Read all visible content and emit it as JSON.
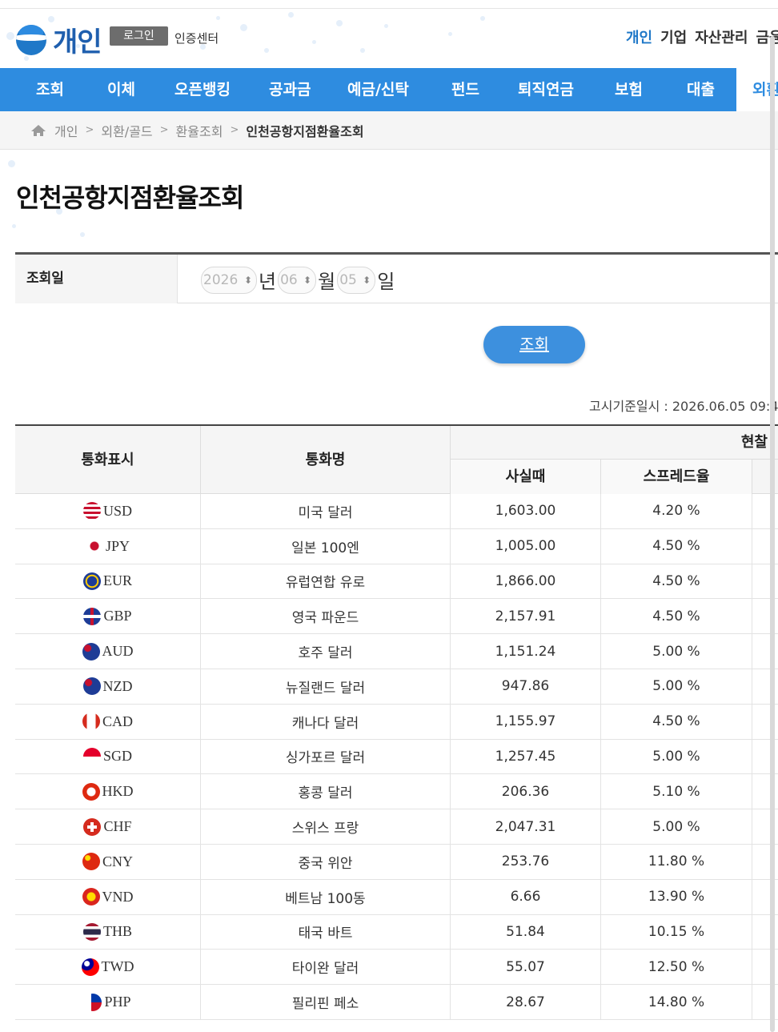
{
  "header": {
    "logo_text": "개인",
    "login_label": "로그인",
    "cert_label": "인증센터",
    "top_links": [
      "개인",
      "기업",
      "자산관리",
      "금융"
    ]
  },
  "gnb": [
    "조회",
    "이체",
    "오픈뱅킹",
    "공과금",
    "예금/신탁",
    "펀드",
    "퇴직연금",
    "보험",
    "대출",
    "외환"
  ],
  "breadcrumb": [
    "개인",
    "외환/골드",
    "환율조회",
    "인천공항지점환율조회"
  ],
  "page_title": "인천공항지점환율조회",
  "search": {
    "label": "조회일",
    "year": "2026",
    "year_unit": "년",
    "month": "06",
    "month_unit": "월",
    "day": "05",
    "day_unit": "일",
    "button": "조회"
  },
  "notice": "고시기준일시 : 2026.06.05 09:4",
  "table": {
    "headers": {
      "symbol": "통화표시",
      "name": "통화명",
      "cash": "현찰",
      "buy": "사실때",
      "spread": "스프레드율"
    },
    "rows": [
      {
        "code": "USD",
        "name": "미국 달러",
        "buy": "1,603.00",
        "spread": "4.20 %",
        "flag": "us"
      },
      {
        "code": "JPY",
        "name": "일본 100엔",
        "buy": "1,005.00",
        "spread": "4.50 %",
        "flag": "jp"
      },
      {
        "code": "EUR",
        "name": "유럽연합 유로",
        "buy": "1,866.00",
        "spread": "4.50 %",
        "flag": "eu"
      },
      {
        "code": "GBP",
        "name": "영국 파운드",
        "buy": "2,157.91",
        "spread": "4.50 %",
        "flag": "gb"
      },
      {
        "code": "AUD",
        "name": "호주 달러",
        "buy": "1,151.24",
        "spread": "5.00 %",
        "flag": "au"
      },
      {
        "code": "NZD",
        "name": "뉴질랜드 달러",
        "buy": "947.86",
        "spread": "5.00 %",
        "flag": "nz"
      },
      {
        "code": "CAD",
        "name": "캐나다 달러",
        "buy": "1,155.97",
        "spread": "4.50 %",
        "flag": "ca"
      },
      {
        "code": "SGD",
        "name": "싱가포르 달러",
        "buy": "1,257.45",
        "spread": "5.00 %",
        "flag": "sg"
      },
      {
        "code": "HKD",
        "name": "홍콩 달러",
        "buy": "206.36",
        "spread": "5.10 %",
        "flag": "hk"
      },
      {
        "code": "CHF",
        "name": "스위스 프랑",
        "buy": "2,047.31",
        "spread": "5.00 %",
        "flag": "ch"
      },
      {
        "code": "CNY",
        "name": "중국 위안",
        "buy": "253.76",
        "spread": "11.80 %",
        "flag": "cn"
      },
      {
        "code": "VND",
        "name": "베트남 100동",
        "buy": "6.66",
        "spread": "13.90 %",
        "flag": "vn"
      },
      {
        "code": "THB",
        "name": "태국 바트",
        "buy": "51.84",
        "spread": "10.15 %",
        "flag": "th"
      },
      {
        "code": "TWD",
        "name": "타이완 달러",
        "buy": "55.07",
        "spread": "12.50 %",
        "flag": "tw"
      },
      {
        "code": "PHP",
        "name": "필리핀 페소",
        "buy": "28.67",
        "spread": "14.80 %",
        "flag": "ph"
      }
    ]
  },
  "colors": {
    "brand": "#2e8ce0",
    "logo": "#1f5fae",
    "button": "#3d90de"
  }
}
